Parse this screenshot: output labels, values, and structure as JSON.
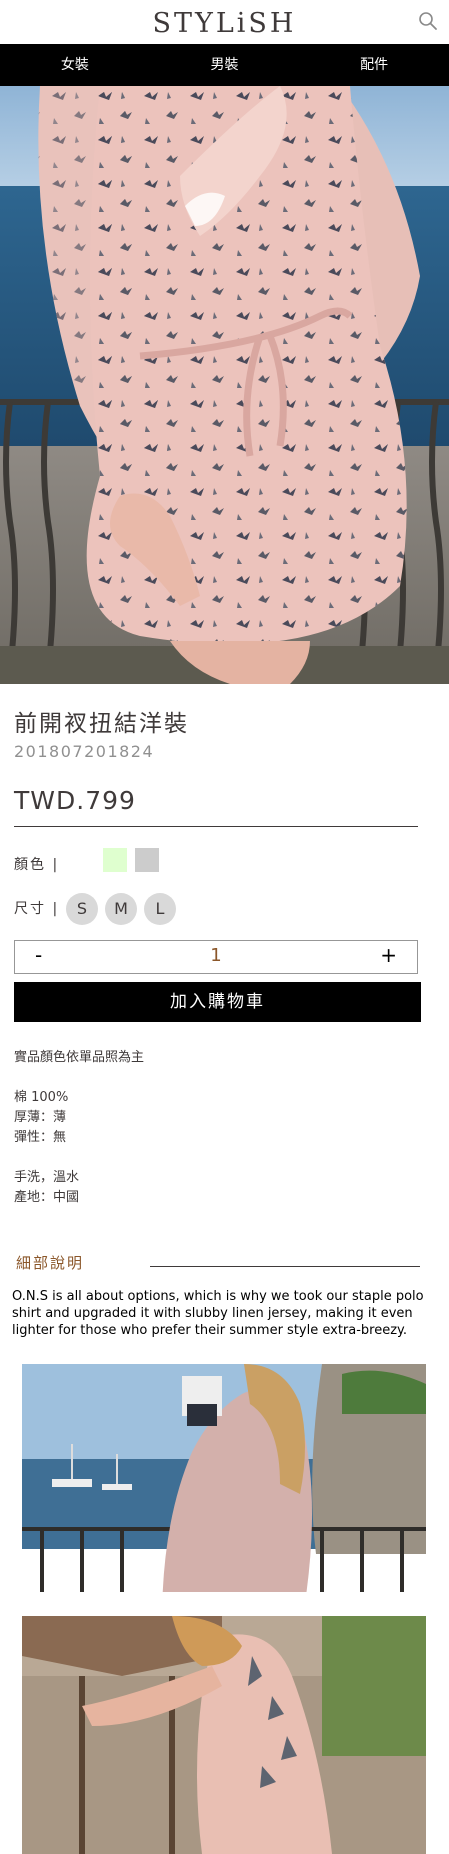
{
  "header": {
    "logo_text": "STYLiSH",
    "search_icon": "search-icon"
  },
  "nav": {
    "items": [
      {
        "label": "女裝"
      },
      {
        "label": "男裝"
      },
      {
        "label": "配件"
      }
    ]
  },
  "product": {
    "title": "前開衩扭結洋裝",
    "id": "201807201824",
    "price": "TWD.799",
    "color_label": "顏色 |",
    "colors": [
      "#dfffcf",
      "#cccccc"
    ],
    "size_label": "尺寸 |",
    "sizes": [
      "S",
      "M",
      "L"
    ],
    "quantity": {
      "minus": "-",
      "value": "1",
      "plus": "+"
    },
    "add_to_cart": "加入購物車",
    "notes": [
      "實品顏色依單品照為主",
      "",
      "棉 100%",
      "厚薄：薄",
      "彈性：無",
      "",
      "手洗，溫水",
      "產地：中國"
    ]
  },
  "details": {
    "heading": "細部說明",
    "story": "O.N.S is all about options, which is why we took our staple polo shirt and upgraded it with slubby linen jersey, making it even lighter for those who prefer their summer style extra-breezy."
  },
  "colors": {
    "nav_bg": "#000000",
    "text": "#3f3a3a",
    "accent": "#8b572a",
    "dress_pink": "#ecc3bc",
    "sea": "#2f5f86"
  }
}
